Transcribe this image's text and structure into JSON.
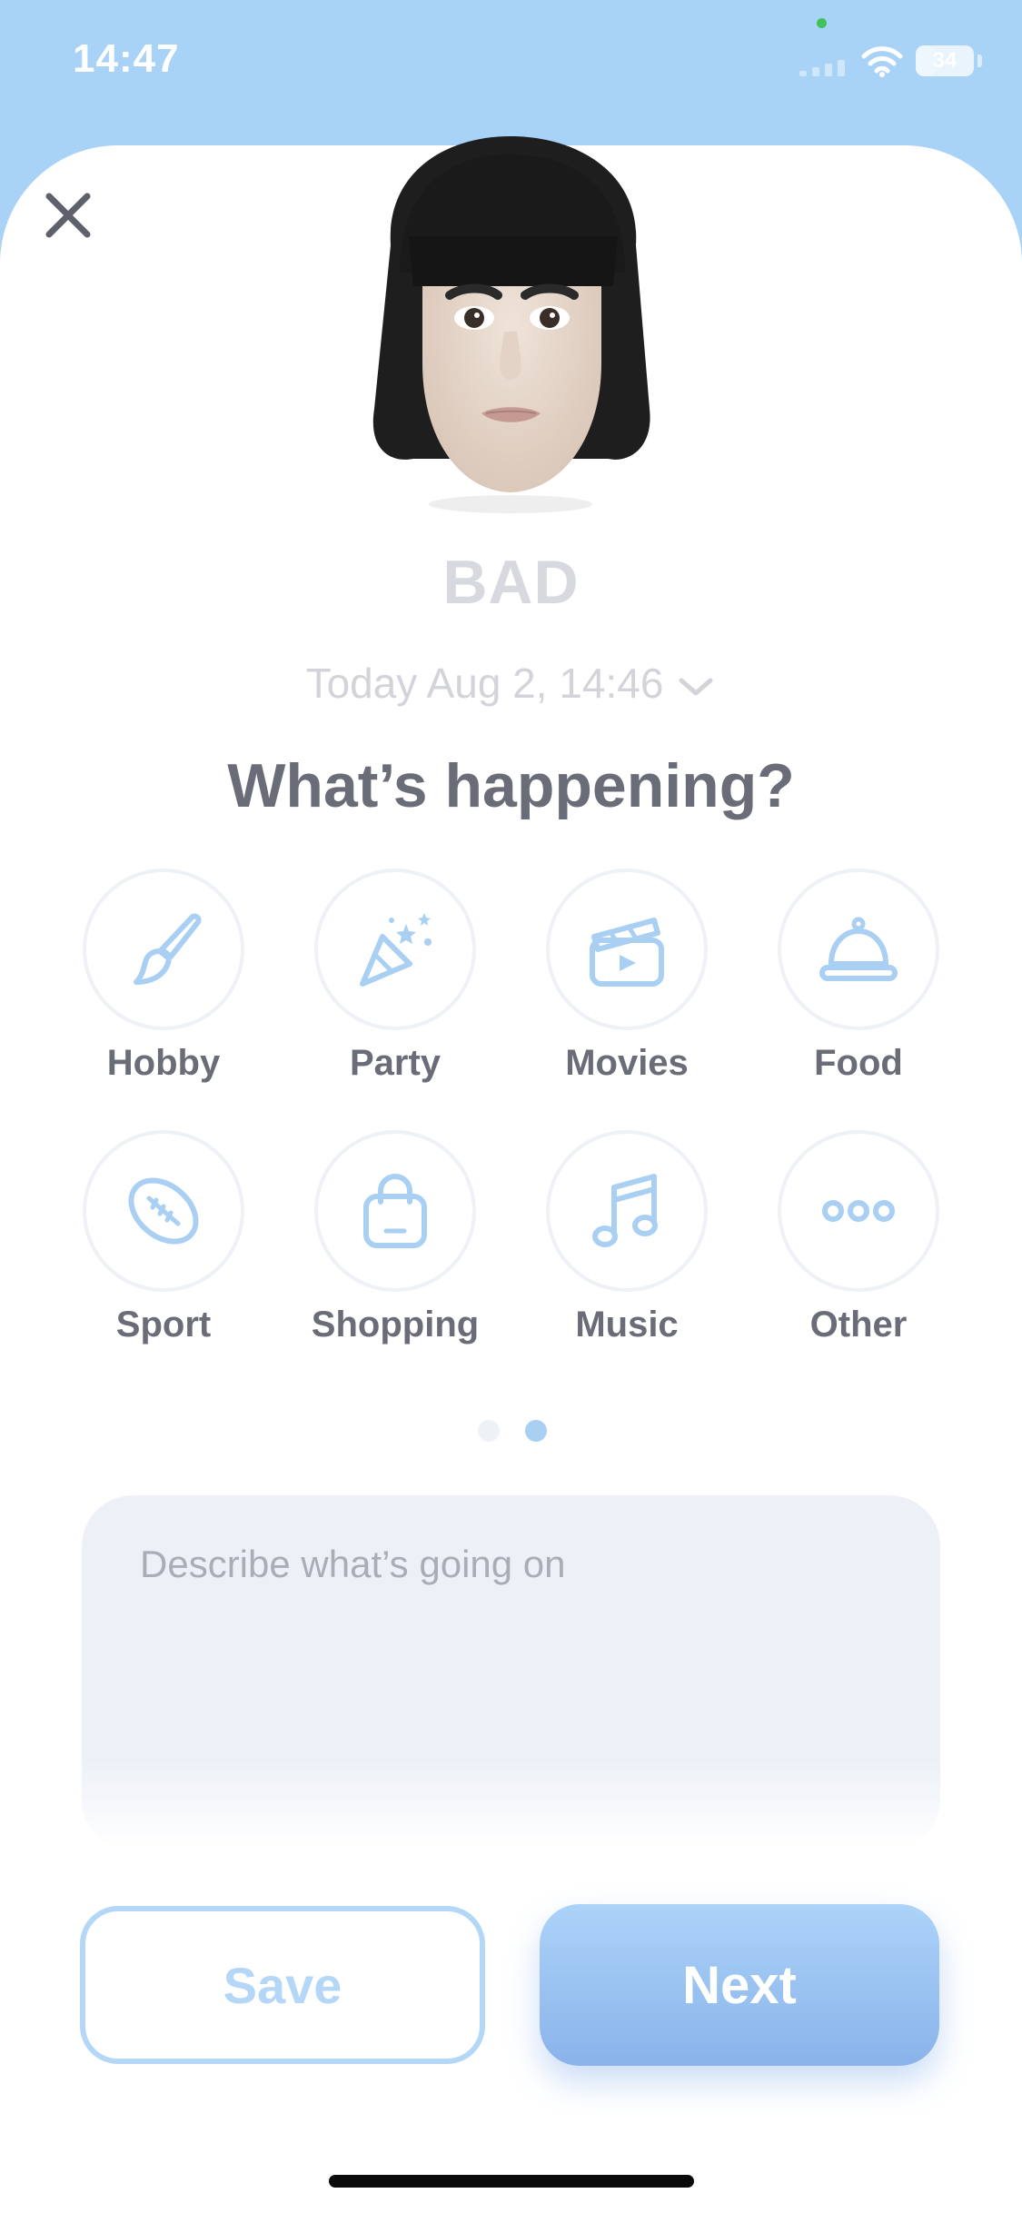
{
  "status_bar": {
    "time": "14:47",
    "battery": "34",
    "battery_level": 0.34
  },
  "icons": {
    "close": "close-icon",
    "chevron": "chevron-down-icon",
    "wifi": "wifi-icon",
    "battery": "battery-icon",
    "signal": "cellular-signal-icon"
  },
  "mood": {
    "label": "BAD"
  },
  "entry": {
    "date": "Today Aug 2, 14:46"
  },
  "heading": "What’s happening?",
  "categories": [
    {
      "label": "Hobby",
      "icon": "paintbrush-icon"
    },
    {
      "label": "Party",
      "icon": "party-popper-icon"
    },
    {
      "label": "Movies",
      "icon": "clapperboard-icon"
    },
    {
      "label": "Food",
      "icon": "cloche-icon"
    },
    {
      "label": "Sport",
      "icon": "football-icon"
    },
    {
      "label": "Shopping",
      "icon": "shopping-bag-icon"
    },
    {
      "label": "Music",
      "icon": "music-note-icon"
    },
    {
      "label": "Other",
      "icon": "more-icon"
    }
  ],
  "pagination": {
    "pages": 2,
    "current": 2
  },
  "description": {
    "placeholder": "Describe what’s going on"
  },
  "buttons": {
    "save": "Save",
    "next": "Next"
  },
  "colors": {
    "background": "#a9d2f7",
    "accent": "#8ab3ea",
    "icon": "#a9cff3",
    "text_dark": "#6a6c78",
    "text_muted": "#d2d4d9"
  }
}
